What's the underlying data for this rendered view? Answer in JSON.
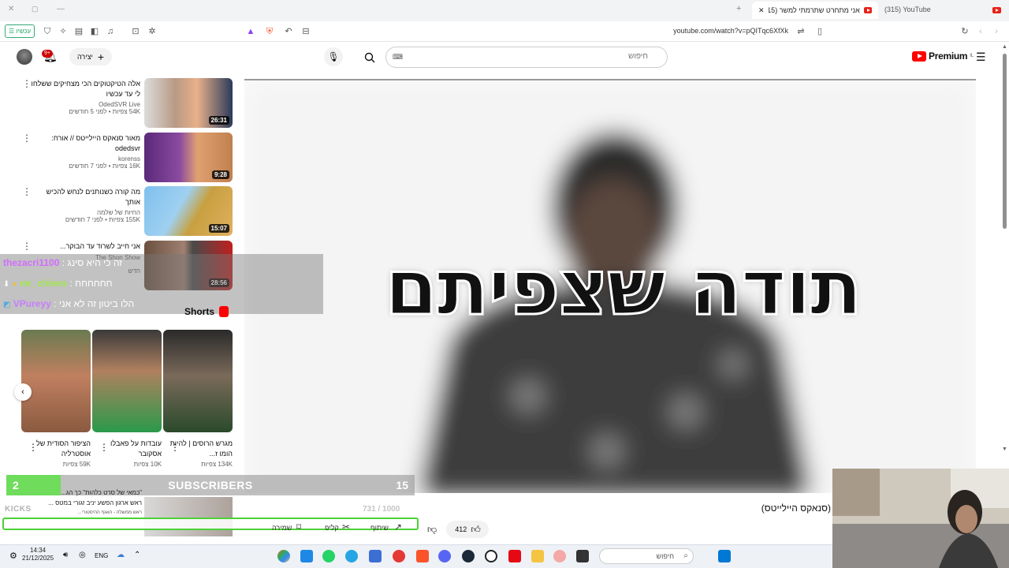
{
  "browser": {
    "tabs": [
      {
        "label": "אני מתחרט שתרמתי למשר (315)",
        "active": true
      },
      {
        "label": "(315) YouTube",
        "active": false
      }
    ],
    "url": "youtube.com/watch?v=pQITqc6XfXk",
    "zoom_label": "עכשיו"
  },
  "header": {
    "search_placeholder": "חיפוש",
    "logo_text": "Premium",
    "logo_region": "IL",
    "create_label": "יצירה",
    "notif_count": "9+"
  },
  "recommendations": [
    {
      "title": "אלה הטיקטוקים הכי מצחיקים ששלחו לי עד עכשיו",
      "channel": "OdedSVR Live",
      "meta": "54K צפיות • לפני 5 חודשים",
      "duration": "26:31"
    },
    {
      "title": "מאור סנאקס היילייטס // אורח: odedsvr",
      "channel": "korenss",
      "meta": "16K צפיות • לפני 7 חודשים",
      "duration": "9:28"
    },
    {
      "title": "מה קורה כשנותנים לנחש להכיש אותך",
      "channel": "החיות של שלמה",
      "meta": "155K צפיות • לפני 7 חודשים",
      "duration": "15:07"
    },
    {
      "title": "אני חייב לשרוד עד הבוקר...",
      "channel": "The Shon Show",
      "meta": "חדש",
      "duration": "28:56"
    }
  ],
  "chat": [
    {
      "user": "thezacri1100",
      "message": "זה כי היא סינג",
      "color": "#d26cff"
    },
    {
      "user": "mr_chines",
      "message": "חחחחחח",
      "color": "#a0e84a"
    },
    {
      "user": "VPureyy",
      "message": "הלו ביטון זה לא אני",
      "color": "#c77dff"
    }
  ],
  "shorts": {
    "heading": "Shorts",
    "items": [
      {
        "title": "מגרש הרוסים | להיות הומו ז...",
        "views": "134K צפיות"
      },
      {
        "title": "עובדות על פאבלו אסקובר",
        "views": "10K צפיות"
      },
      {
        "title": "הציפור הסודית של אוסטרליה",
        "views": "59K צפיות"
      }
    ]
  },
  "subscribers_widget": {
    "label": "SUBSCRIBERS",
    "current": "2",
    "goal": "15",
    "progress": 0.133
  },
  "kicks_widget": {
    "label": "KICKS",
    "count": "731",
    "goal": "/ 1000",
    "progress": 0.731,
    "news_line1": "\"כמאי של סרט כלהות\" כך הג...",
    "news_line2": "ראש ארגון הפשע יניב זגורי במטס ...",
    "news_line3": "ראש ממשלה - האגף ההיסטורי..."
  },
  "player": {
    "overlay_text": "תודה שצפיתם",
    "video_title": "(סנאקס היילייטס)",
    "likes": "412",
    "actions": [
      "שיתוף",
      "קליפ",
      "שמירה"
    ]
  },
  "taskbar": {
    "time": "14:34",
    "date": "21/12/2025",
    "lang": "ENG",
    "search_placeholder": "חיפוש"
  }
}
